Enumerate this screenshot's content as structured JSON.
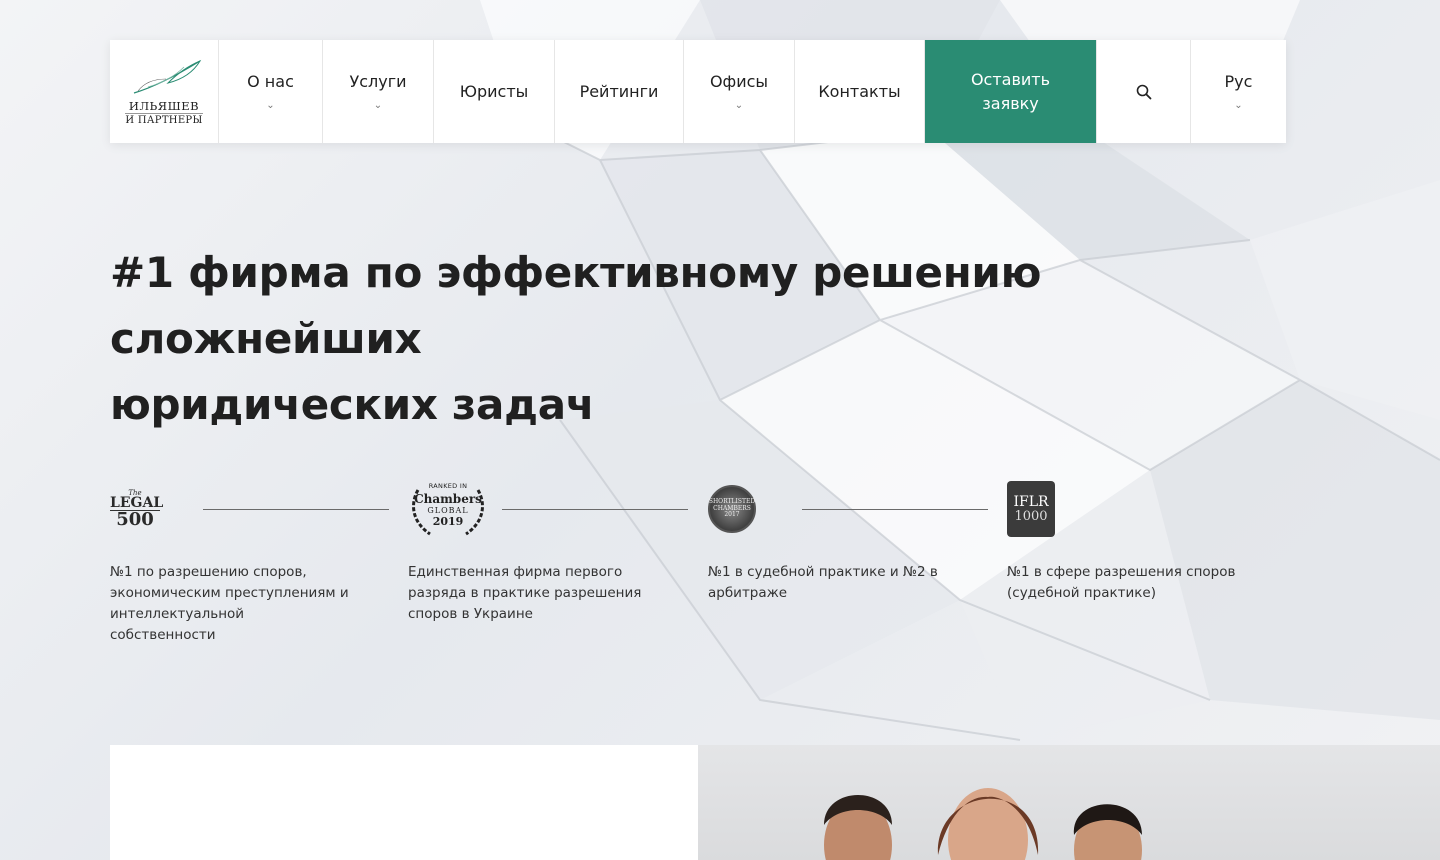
{
  "nav": {
    "logo": {
      "line1": "ИЛЬЯШЕВ",
      "line2": "И ПАРТНЕРЫ"
    },
    "items": [
      {
        "label": "О нас",
        "dropdown": true
      },
      {
        "label": "Услуги",
        "dropdown": true
      },
      {
        "label": "Юристы",
        "dropdown": false
      },
      {
        "label": "Рейтинги",
        "dropdown": false
      },
      {
        "label": "Офисы",
        "dropdown": true
      },
      {
        "label": "Контакты",
        "dropdown": false
      }
    ],
    "cta": {
      "line1": "Оставить",
      "line2": "заявку"
    },
    "language": "Рус",
    "icons": {
      "search": "search-icon",
      "dropdown": "chevron-down-icon"
    }
  },
  "hero": {
    "title_line1": "#1 фирма по эффективному решению сложнейших",
    "title_line2": "юридических задач"
  },
  "ratings": [
    {
      "logo": {
        "the": "The",
        "legal": "LEGAL",
        "num": "500"
      },
      "description": "№1 по разрешению споров, экономическим преступлениям и интеллектуальной собственности"
    },
    {
      "logo": {
        "ranked": "RANKED IN",
        "name": "Chambers",
        "global": "GLOBAL",
        "year": "2019"
      },
      "description": "Единственная фирма первого разряда в практике разрешения споров в Украине"
    },
    {
      "logo": {
        "line1": "SHORTLISTED",
        "line2": "CHAMBERS",
        "year": "2017"
      },
      "description": "№1 в судебной практике и №2 в арбитраже"
    },
    {
      "logo": {
        "name": "IFLR",
        "num": "1000"
      },
      "description": "№1 в сфере разрешения споров (судебной практике)"
    }
  ],
  "colors": {
    "accent": "#2a8c73",
    "text": "#202020",
    "background": "#eef0f3"
  }
}
